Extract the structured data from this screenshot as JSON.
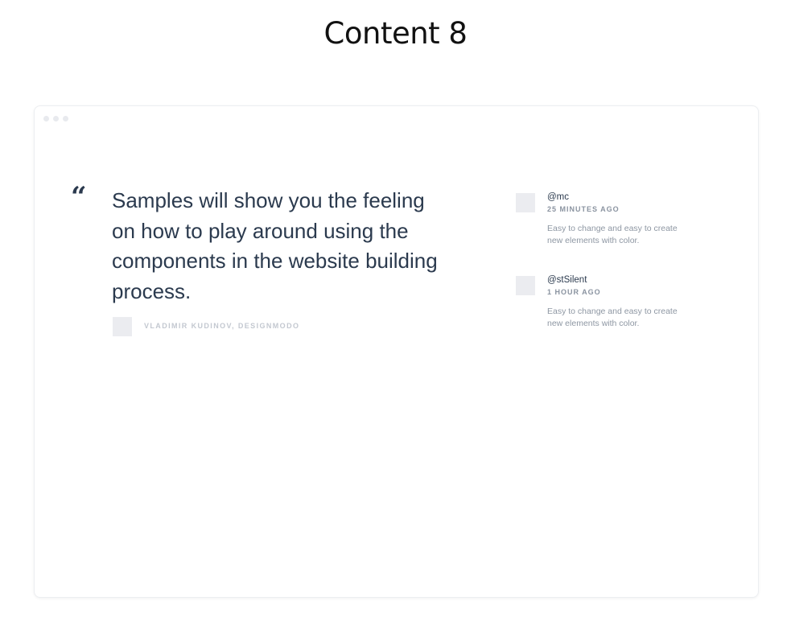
{
  "page": {
    "title": "Content 8"
  },
  "window": {
    "control_dots": 3
  },
  "quote": {
    "mark": "“",
    "text": "Samples will show you the feeling on how to play around using the components in the website building process.",
    "author": "VLADIMIR KUDINOV, DESIGNMODO"
  },
  "comments": [
    {
      "user": "@mc",
      "time": "25 MINUTES AGO",
      "text": "Easy to change and easy to create new elements with color."
    },
    {
      "user": "@stSilent",
      "time": "1 HOUR AGO",
      "text": "Easy to change and easy to create new elements with color."
    }
  ],
  "colors": {
    "heading": "#111111",
    "quote_text": "#2b3a4e",
    "muted": "#8e97a3",
    "avatar_placeholder": "#ebecf0"
  }
}
